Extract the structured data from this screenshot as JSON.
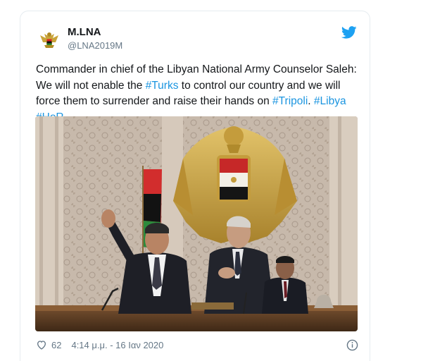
{
  "tweet": {
    "display_name": "M.LNA",
    "handle": "@LNA2019M",
    "text_segments": [
      {
        "text": "Commander in chief of the Libyan National Army Counselor Saleh: We will not enable the ",
        "hashtag": false
      },
      {
        "text": "#Turks",
        "hashtag": true
      },
      {
        "text": " to control our country and we will force them to surrender and raise their hands on ",
        "hashtag": false
      },
      {
        "text": "#Tripoli",
        "hashtag": true
      },
      {
        "text": ".  ",
        "hashtag": false
      },
      {
        "text": "#Libya",
        "hashtag": true
      },
      {
        "text": " ",
        "hashtag": false
      },
      {
        "text": "#HoR",
        "hashtag": true
      }
    ],
    "like_count": "62",
    "timestamp": "4:14 μ.μ. - 16 Ιαν 2020"
  },
  "icons": {
    "avatar": "libyan-national-army-emblem",
    "brand": "twitter-bird-icon",
    "like": "heart-icon",
    "info": "info-icon"
  },
  "colors": {
    "link": "#1b95e0",
    "text": "#14171a",
    "secondary": "#657786",
    "twitter_blue": "#1da1f2"
  }
}
